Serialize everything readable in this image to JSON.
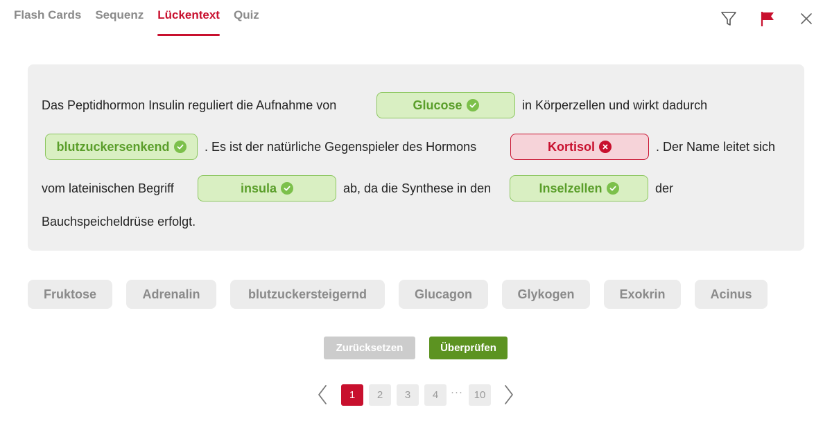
{
  "tabs": [
    {
      "label": "Flash Cards"
    },
    {
      "label": "Sequenz"
    },
    {
      "label": "Lückentext"
    },
    {
      "label": "Quiz"
    }
  ],
  "active_tab": "Lückentext",
  "icons": {
    "filter": "filter-icon",
    "flag": "flag-icon",
    "close": "close-icon"
  },
  "colors": {
    "accent": "#c8102e",
    "correct": "#5a9e2a",
    "check_button": "#5c9321",
    "reset_button": "#cccccc"
  },
  "text": {
    "t1": "Das Peptidhormon Insulin reguliert die Aufnahme von",
    "t2": "in Körperzellen und wirkt dadurch",
    "t3": ". Es ist der natürliche Gegenspieler des Hormons",
    "t4": ". Der Name leitet sich",
    "t5": "vom lateinischen Begriff",
    "t6": "ab, da die Synthese in den",
    "t7": "der",
    "t8": "Bauchspeicheldrüse erfolgt."
  },
  "blanks": [
    {
      "value": "Glucose",
      "status": "correct"
    },
    {
      "value": "blutzuckersenkend",
      "status": "correct"
    },
    {
      "value": "Kortisol",
      "status": "wrong"
    },
    {
      "value": "insula",
      "status": "correct"
    },
    {
      "value": "Inselzellen",
      "status": "correct"
    }
  ],
  "options": [
    "Fruktose",
    "Adrenalin",
    "blutzuckersteigernd",
    "Glucagon",
    "Glykogen",
    "Exokrin",
    "Acinus"
  ],
  "buttons": {
    "reset": "Zurücksetzen",
    "check": "Überprüfen"
  },
  "pagination": {
    "pages": [
      "1",
      "2",
      "3",
      "4",
      "10"
    ],
    "current": "1",
    "ellipsis": "···"
  }
}
